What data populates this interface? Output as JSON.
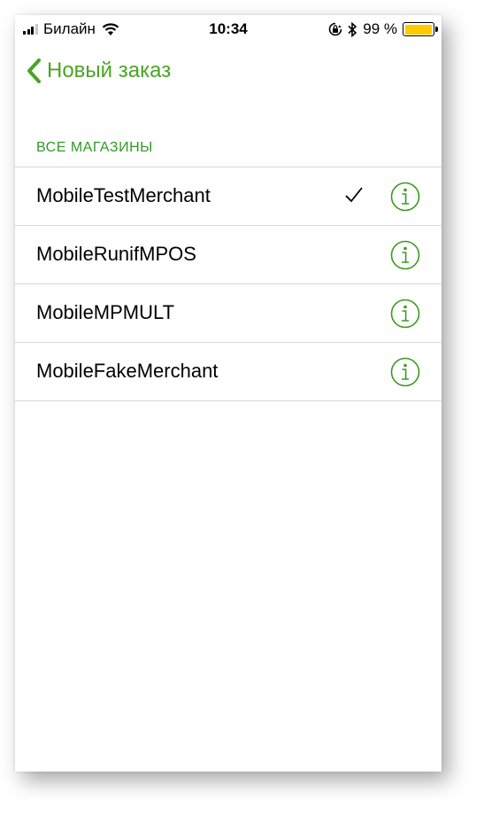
{
  "status_bar": {
    "carrier": "Билайн",
    "time": "10:34",
    "battery_percent": "99 %",
    "battery_level": 0.99,
    "battery_color": "#fecb00",
    "icons": [
      "signal-icon",
      "wifi-icon",
      "orientation-lock-icon",
      "bluetooth-icon",
      "battery-icon"
    ]
  },
  "nav": {
    "back_label": "Новый заказ",
    "accent_color": "#4ba424"
  },
  "section": {
    "header": "ВСЕ МАГАЗИНЫ"
  },
  "merchants": [
    {
      "name": "MobileTestMerchant",
      "selected": true
    },
    {
      "name": "MobileRunifMPOS",
      "selected": false
    },
    {
      "name": "MobileMPMULT",
      "selected": false
    },
    {
      "name": "MobileFakeMerchant",
      "selected": false
    }
  ]
}
